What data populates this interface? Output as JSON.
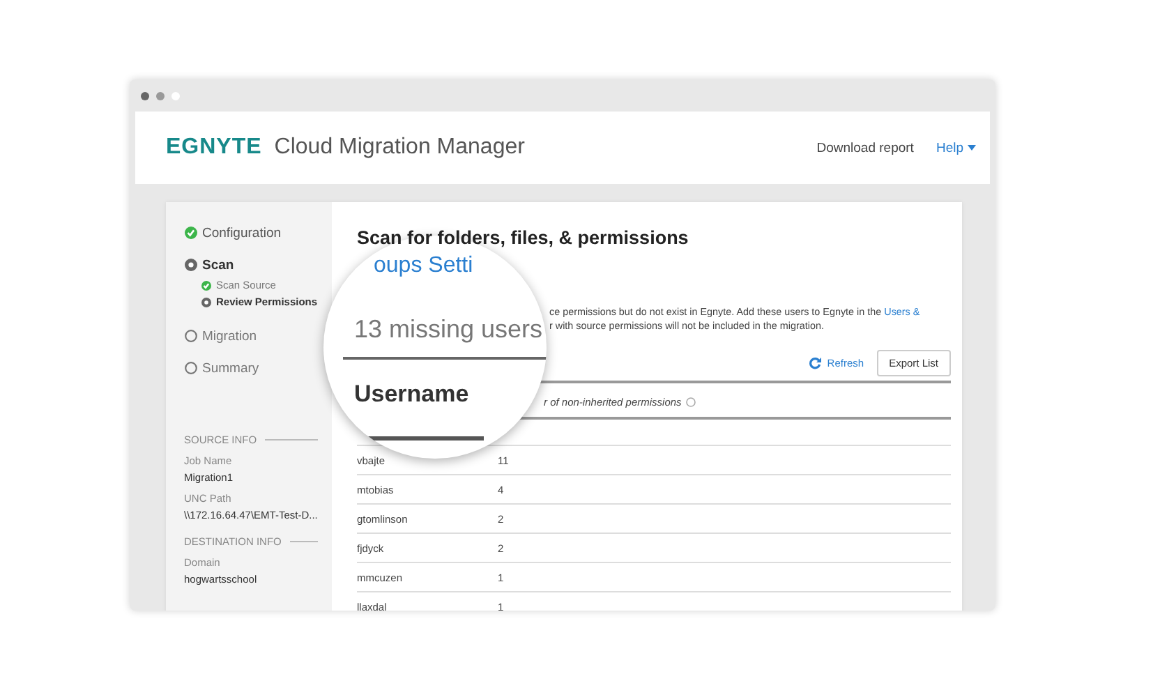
{
  "header": {
    "logo": "EGNYTE",
    "app_title": "Cloud Migration Manager",
    "links": [
      {
        "label": "Download report",
        "dropdown": false
      },
      {
        "label": "Help",
        "dropdown": true
      }
    ]
  },
  "sidebar": {
    "steps": [
      {
        "label": "Configuration",
        "completed": true,
        "selected": false
      },
      {
        "label": "Scan",
        "completed": false,
        "selected": true,
        "children": [
          {
            "label": "Scan Source",
            "completed": true,
            "selected": false
          },
          {
            "label": "Review Permissions",
            "completed": false,
            "selected": true
          }
        ]
      },
      {
        "label": "Migration",
        "completed": false,
        "selected": false
      },
      {
        "label": "Summary",
        "completed": false,
        "selected": false
      }
    ],
    "sections": [
      {
        "heading": "SOURCE INFO",
        "fields": [
          {
            "label": "Job Name",
            "value": "Migration1"
          },
          {
            "label": "UNC Path",
            "value": "\\\\172.16.64.47\\EMT-Test-D..."
          }
        ]
      },
      {
        "heading": "DESTINATION INFO",
        "fields": [
          {
            "label": "Domain",
            "value": "hogwartsschool"
          }
        ]
      }
    ]
  },
  "main": {
    "title": "Scan for folders, files, & permissions",
    "description": [
      {
        "text": "ce permissions but do not exist in Egnyte. Add these users to Egnyte in the",
        "link": "Users &"
      },
      {
        "text": "r with source permissions will not be included in the migration."
      }
    ],
    "refresh": "Refresh",
    "export": "Export List",
    "table": {
      "column_2": "r of non-inherited permissions",
      "rows": [
        [
          "vbajte",
          "11"
        ],
        [
          "mtobias",
          "4"
        ],
        [
          "gtomlinson",
          "2"
        ],
        [
          "fjdyck",
          "2"
        ],
        [
          "mmcuzen",
          "1"
        ],
        [
          "llaxdal",
          "1"
        ]
      ]
    }
  },
  "magnifier": {
    "heading": "oups Setti",
    "count_text": "13 missing users",
    "column_header": "Username"
  }
}
